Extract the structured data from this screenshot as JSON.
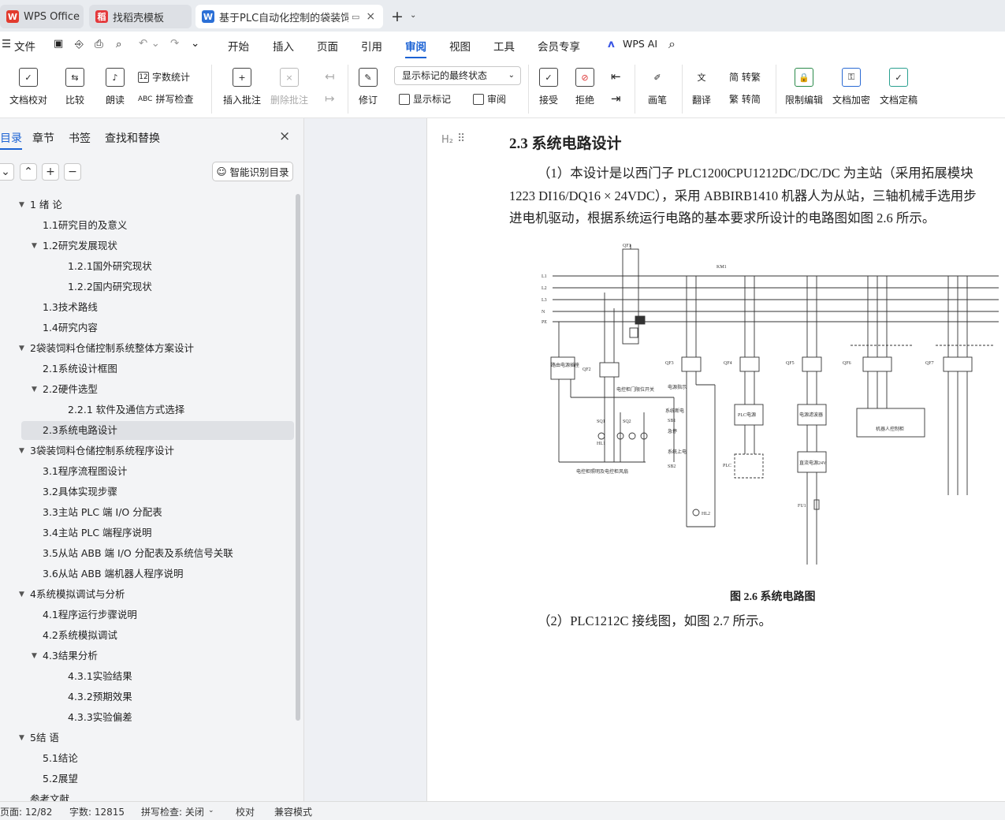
{
  "tabs": [
    {
      "label": "WPS Office"
    },
    {
      "label": "找稻壳模板"
    },
    {
      "label": "基于PLC自动化控制的袋装饲料"
    }
  ],
  "menu": {
    "file": "文件",
    "items": [
      "开始",
      "插入",
      "页面",
      "引用",
      "审阅",
      "视图",
      "工具",
      "会员专享"
    ],
    "active": "审阅",
    "wps_ai": "WPS AI"
  },
  "ribbon": {
    "doc_check": "文档校对",
    "compare": "比较",
    "read_aloud": "朗读",
    "word_count": "字数统计",
    "spell_check": "拼写检查",
    "insert_comment": "插入批注",
    "delete_comment": "删除批注",
    "revise": "修订",
    "markup_select": "显示标记的最终状态",
    "show_markup": "显示标记",
    "review": "审阅",
    "accept": "接受",
    "reject": "拒绝",
    "pen": "画笔",
    "translate": "翻译",
    "to_traditional": "简 转繁",
    "to_simplified": "繁 转简",
    "restrict_edit": "限制编辑",
    "encrypt": "文档加密",
    "finalize": "文档定稿"
  },
  "sidebar": {
    "tabs": [
      "目录",
      "章节",
      "书签",
      "查找和替换"
    ],
    "smart_button": "智能识别目录",
    "toc": [
      {
        "label": "1 绪  论",
        "level": 1,
        "expand": "▼"
      },
      {
        "label": "1.1研究目的及意义",
        "level": 2,
        "expand": ""
      },
      {
        "label": "1.2研究发展现状",
        "level": 2,
        "expand": "▼"
      },
      {
        "label": "1.2.1国外研究现状",
        "level": 3,
        "expand": ""
      },
      {
        "label": "1.2.2国内研究现状",
        "level": 3,
        "expand": ""
      },
      {
        "label": "1.3技术路线",
        "level": 2,
        "expand": ""
      },
      {
        "label": "1.4研究内容",
        "level": 2,
        "expand": ""
      },
      {
        "label": "2袋装饲料仓储控制系统整体方案设计",
        "level": 1,
        "expand": "▼"
      },
      {
        "label": "2.1系统设计框图",
        "level": 2,
        "expand": ""
      },
      {
        "label": "2.2硬件选型",
        "level": 2,
        "expand": "▼"
      },
      {
        "label": "2.2.1 软件及通信方式选择",
        "level": 3,
        "expand": ""
      },
      {
        "label": "2.3系统电路设计",
        "level": 2,
        "expand": "",
        "selected": true
      },
      {
        "label": "3袋装饲料仓储控制系统程序设计",
        "level": 1,
        "expand": "▼"
      },
      {
        "label": "3.1程序流程图设计",
        "level": 2,
        "expand": ""
      },
      {
        "label": "3.2具体实现步骤",
        "level": 2,
        "expand": ""
      },
      {
        "label": "3.3主站 PLC 端 I/O 分配表",
        "level": 2,
        "expand": ""
      },
      {
        "label": "3.4主站 PLC 端程序说明",
        "level": 2,
        "expand": ""
      },
      {
        "label": "3.5从站 ABB 端 I/O 分配表及系统信号关联",
        "level": 2,
        "expand": ""
      },
      {
        "label": "3.6从站 ABB 端机器人程序说明",
        "level": 2,
        "expand": ""
      },
      {
        "label": "4系统模拟调试与分析",
        "level": 1,
        "expand": "▼"
      },
      {
        "label": "4.1程序运行步骤说明",
        "level": 2,
        "expand": ""
      },
      {
        "label": "4.2系统模拟调试",
        "level": 2,
        "expand": ""
      },
      {
        "label": "4.3结果分析",
        "level": 2,
        "expand": "▼"
      },
      {
        "label": "4.3.1实验结果",
        "level": 3,
        "expand": ""
      },
      {
        "label": "4.3.2预期效果",
        "level": 3,
        "expand": ""
      },
      {
        "label": "4.3.3实验偏差",
        "level": 3,
        "expand": ""
      },
      {
        "label": "5结  语",
        "level": 1,
        "expand": "▼"
      },
      {
        "label": "5.1结论",
        "level": 2,
        "expand": ""
      },
      {
        "label": "5.2展望",
        "level": 2,
        "expand": ""
      },
      {
        "label": "参考文献",
        "level": 1,
        "expand": ""
      }
    ]
  },
  "document": {
    "heading_marker": "H₂",
    "heading": "2.3  系统电路设计",
    "para1": [
      "（1）本设计是以西门子 PLC1200CPU1212DC/DC/DC 为主站（采用拓展模块",
      "1223 DI16/DQ16 × 24VDC），采用 ABBIRB1410 机器人为从站，三轴机械手选用步",
      "进电机驱动，根据系统运行电路的基本要求所设计的电路图如图 2.6 所示。"
    ],
    "caption": "图 2.6 系统电路图",
    "para2": "（2）PLC1212C 接线图，如图 2.7 所示。",
    "diagram": {
      "lines": [
        "L1",
        "L2",
        "L3",
        "N",
        "PE"
      ],
      "breakers": [
        "QF1",
        "QF2",
        "QF3",
        "QF4",
        "QF5",
        "QF6",
        "QF7"
      ],
      "switch": "KM1",
      "labels": [
        "路由电源插座",
        "电控柜门限位开关",
        "电控柜照明及电控柜风扇",
        "电源指示",
        "系统断电",
        "急停",
        "系统上电",
        "PLC电源",
        "PLC",
        "电源滤波器",
        "直流电源24V",
        "FU1",
        "机器人控制柜",
        "电源指示",
        "HL1",
        "HL2",
        "SQ1",
        "SQ2",
        "SB1",
        "SB2"
      ]
    }
  },
  "status": {
    "page": "页面: 12/82",
    "words": "字数: 12815",
    "spell": "拼写检查: 关闭",
    "proof": "校对",
    "compat": "兼容模式"
  }
}
